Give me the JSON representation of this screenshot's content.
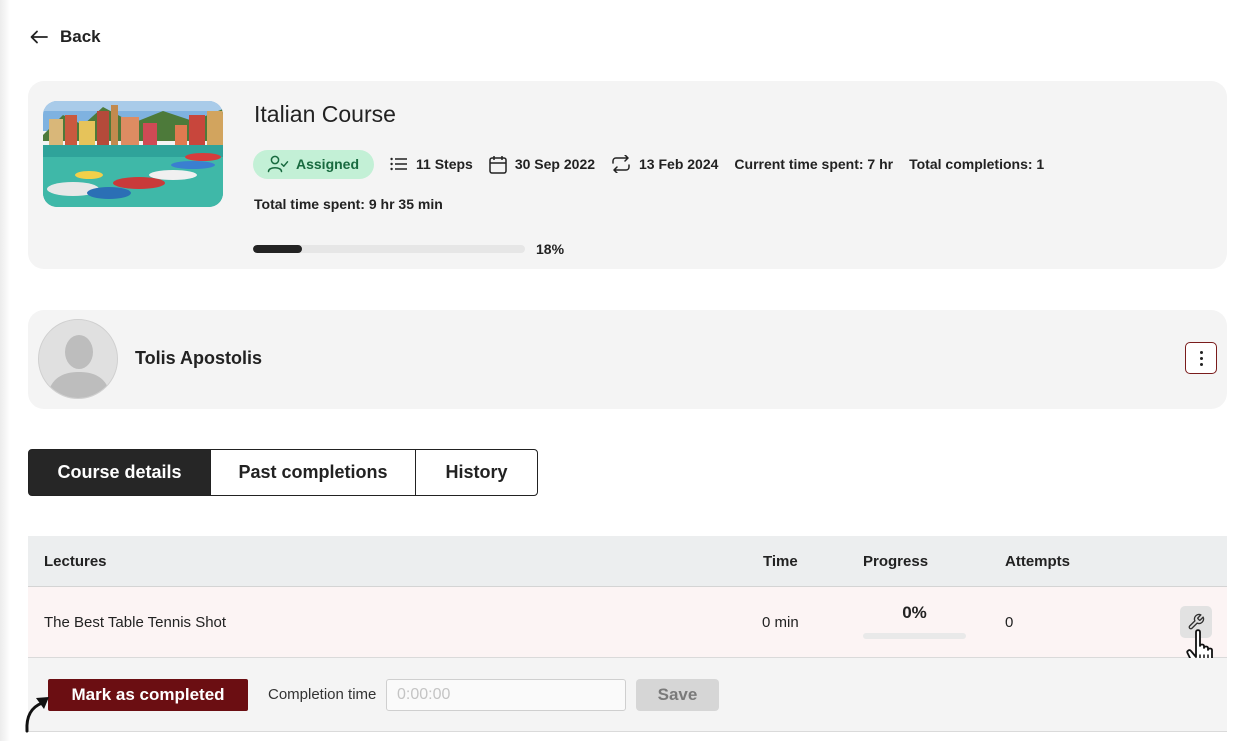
{
  "nav": {
    "back_label": "Back"
  },
  "course": {
    "title": "Italian Course",
    "status": "Assigned",
    "steps": "11 Steps",
    "start_date": "30 Sep 2022",
    "renew_date": "13 Feb 2024",
    "current_time_spent": "Current time spent: 7 hr",
    "total_completions": "Total completions: 1",
    "total_time_spent": "Total time spent: 9 hr 35 min",
    "progress_percent": 18,
    "progress_label": "18%"
  },
  "user": {
    "name": "Tolis Apostolis"
  },
  "tabs": [
    {
      "label": "Course details",
      "active": true
    },
    {
      "label": "Past completions",
      "active": false
    },
    {
      "label": "History",
      "active": false
    }
  ],
  "table": {
    "headers": {
      "lectures": "Lectures",
      "time": "Time",
      "progress": "Progress",
      "attempts": "Attempts"
    },
    "rows": [
      {
        "lecture": "The Best Table Tennis Shot",
        "time": "0 min",
        "progress": "0%",
        "progress_percent": 0,
        "attempts": "0"
      }
    ]
  },
  "actions": {
    "mark_label": "Mark as completed",
    "completion_time_label": "Completion time",
    "completion_time_placeholder": "0:00:00",
    "save_label": "Save"
  },
  "icons": {
    "back": "arrow-left-icon",
    "status": "user-check-icon",
    "steps": "list-icon",
    "date": "calendar-icon",
    "renew": "repeat-icon",
    "menu": "kebab-menu-icon",
    "row_action": "wrench-icon"
  },
  "colors": {
    "accent": "#6b0e12",
    "badge_bg": "#c3f0d6",
    "badge_text": "#186a3f",
    "dark": "#262626"
  }
}
